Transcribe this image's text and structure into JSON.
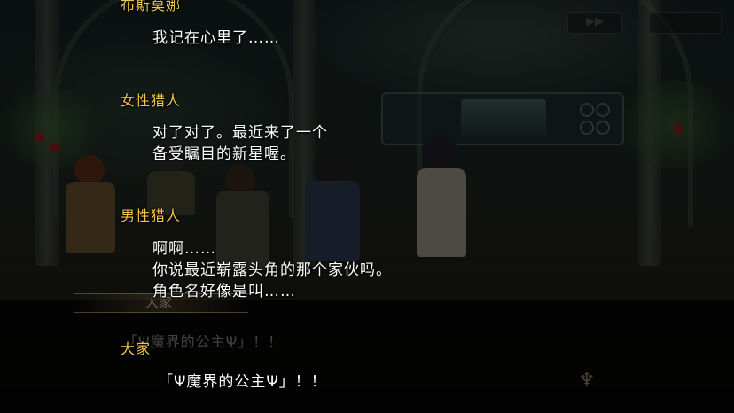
{
  "scene": {
    "skip_button_icon": "fast-forward-icon",
    "emblem_icon": "crest-icon",
    "background_nameplate": "大家",
    "background_line": "「Ψ魔界的公主Ψ」！！"
  },
  "log": {
    "entries": [
      {
        "speaker": "布斯莫娜",
        "lines": [
          "我记在心里了……"
        ]
      },
      {
        "speaker": "女性猎人",
        "lines": [
          "对了对了。最近来了一个",
          "备受瞩目的新星喔。"
        ]
      },
      {
        "speaker": "男性猎人",
        "lines": [
          "啊啊……",
          "你说最近崭露头角的那个家伙吗。",
          "角色名好像是叫……"
        ]
      },
      {
        "speaker": "大家",
        "lines": [
          "「Ψ魔界的公主Ψ」！！"
        ]
      }
    ]
  },
  "colors": {
    "speaker": "#f2c84a",
    "dialogue": "#ffffff",
    "overlay": "#000000"
  }
}
